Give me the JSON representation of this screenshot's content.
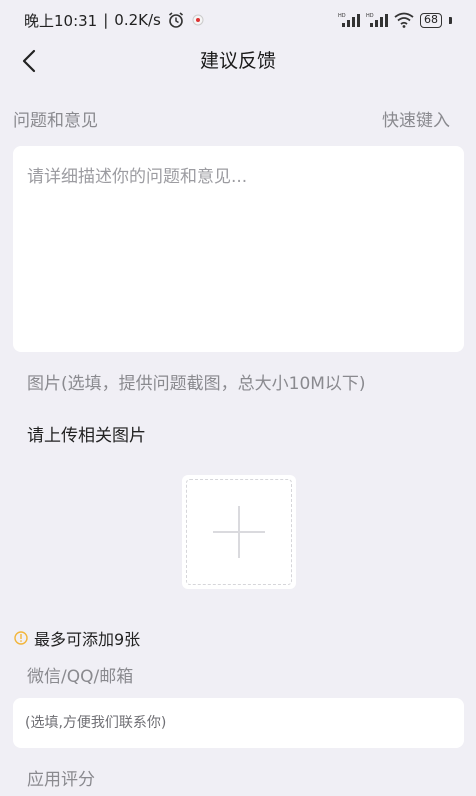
{
  "status_bar": {
    "time": "晚上10:31",
    "speed": "0.2K/s",
    "battery": "68"
  },
  "header": {
    "title": "建议反馈"
  },
  "feedback": {
    "label": "问题和意见",
    "quick_input": "快速键入",
    "placeholder": "请详细描述你的问题和意见..."
  },
  "images": {
    "hint": "图片(选填，提供问题截图，总大小10M以下)",
    "upload_label": "请上传相关图片",
    "max_tip": "最多可添加9张"
  },
  "contact": {
    "label": "微信/QQ/邮箱",
    "placeholder": "(选填,方便我们联系你)"
  },
  "rating": {
    "label": "应用评分"
  },
  "colors": {
    "background": "#f0eff5",
    "card": "#ffffff",
    "label_gray": "#8a8a8f",
    "tip_icon": "#f2b53a"
  }
}
